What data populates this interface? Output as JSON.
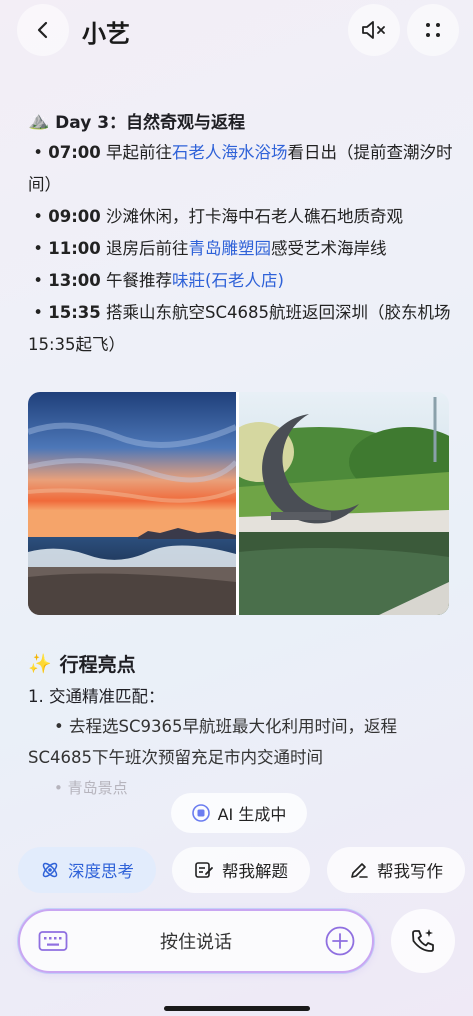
{
  "header": {
    "title": "小艺"
  },
  "day": {
    "emoji": "⛰️",
    "title": "Day 3：自然奇观与返程",
    "items": [
      {
        "time": "07:00",
        "pre": " 早起前往",
        "link": "石老人海水浴场",
        "post": "看日出（提前查潮汐时间）"
      },
      {
        "time": "09:00",
        "pre": " 沙滩休闲，打卡海中石老人礁石地质奇观",
        "link": "",
        "post": ""
      },
      {
        "time": "11:00",
        "pre": " 退房后前往",
        "link": "青岛雕塑园",
        "post": "感受艺术海岸线"
      },
      {
        "time": "13:00",
        "pre": " 午餐推荐",
        "link": "味莊(石老人店)",
        "post": ""
      },
      {
        "time": "15:35",
        "pre": " 搭乘山东航空SC4685航班返回深圳（胶东机场15:35起飞）",
        "link": "",
        "post": ""
      }
    ]
  },
  "highlights": {
    "emoji": "✨",
    "title": "行程亮点",
    "sub": "1. 交通精准匹配：",
    "body": "• 去程选SC9365早航班最大化利用时间，返程SC4685下午班次预留充足市内交通时间",
    "faded": "• 青岛景点"
  },
  "status": {
    "generating": "AI 生成中"
  },
  "chips": {
    "deep": "深度思考",
    "solve": "帮我解题",
    "write": "帮我写作"
  },
  "input": {
    "placeholder": "按住说话"
  },
  "colors": {
    "link": "#2f62d8",
    "accent_border": "#c9a6f2"
  }
}
